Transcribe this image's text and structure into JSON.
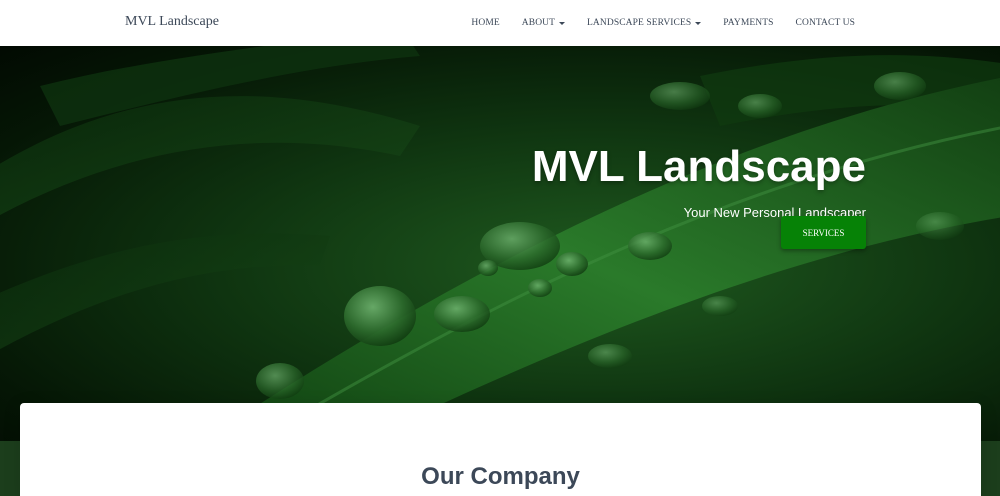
{
  "navbar": {
    "brand": "MVL Landscape",
    "items": [
      {
        "label": "HOME",
        "dropdown": false
      },
      {
        "label": "ABOUT",
        "dropdown": true
      },
      {
        "label": "LANDSCAPE SERVICES",
        "dropdown": true
      },
      {
        "label": "PAYMENTS",
        "dropdown": false
      },
      {
        "label": "CONTACT US",
        "dropdown": false
      }
    ]
  },
  "hero": {
    "title": "MVL Landscape",
    "subtitle": "Your New Personal Landscaper",
    "button_label": "SERVICES"
  },
  "section": {
    "title": "Our Company"
  },
  "colors": {
    "accent": "#068206",
    "text_dark": "#3c4858",
    "hero_dark": "#051605",
    "band": "#1c3e1c"
  }
}
